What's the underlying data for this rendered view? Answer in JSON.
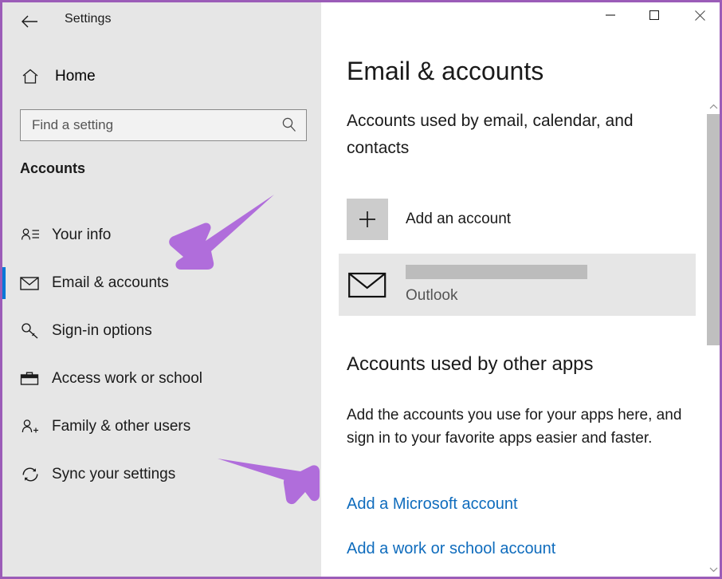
{
  "window": {
    "title": "Settings",
    "back_icon": "back-arrow-icon",
    "minimize_label": "—",
    "maximize_label": "☐",
    "close_label": "✕",
    "border_color": "#9b5cb8"
  },
  "sidebar": {
    "home_label": "Home",
    "home_icon": "home-icon",
    "search": {
      "placeholder": "Find a setting",
      "value": "",
      "icon": "search-icon"
    },
    "section_title": "Accounts",
    "selected_accent_color": "#0078d7",
    "items": [
      {
        "label": "Your info",
        "icon": "user-card-icon",
        "selected": false
      },
      {
        "label": "Email & accounts",
        "icon": "envelope-icon",
        "selected": true
      },
      {
        "label": "Sign-in options",
        "icon": "key-icon",
        "selected": false
      },
      {
        "label": "Access work or school",
        "icon": "briefcase-icon",
        "selected": false
      },
      {
        "label": "Family & other users",
        "icon": "user-plus-icon",
        "selected": false
      },
      {
        "label": "Sync your settings",
        "icon": "sync-refresh-icon",
        "selected": false
      }
    ]
  },
  "content": {
    "page_title": "Email & accounts",
    "sub_heading": "Accounts used by email, calendar, and contacts",
    "add_account": {
      "label": "Add an account",
      "icon": "plus-icon"
    },
    "account_tile": {
      "icon": "envelope-icon",
      "redacted_email": "",
      "provider": "Outlook"
    },
    "other_apps": {
      "heading": "Accounts used by other apps",
      "body": "Add the accounts you use for your apps here, and sign in to your favorite apps easier and faster.",
      "links": [
        {
          "label": "Add a Microsoft account",
          "color": "#0f6cbd"
        },
        {
          "label": "Add a work or school account",
          "color": "#0f6cbd"
        }
      ]
    }
  },
  "scrollbar": {
    "up_icon": "chevron-up-icon",
    "down_icon": "chevron-down-icon",
    "thumb_color": "#bfbfbf"
  },
  "annotations": {
    "arrow_color": "#b06ddb",
    "arrows": [
      {
        "name": "arrow-pointing-email-accounts",
        "target": "Email & accounts"
      },
      {
        "name": "arrow-pointing-add-microsoft-account",
        "target": "Add a Microsoft account"
      }
    ]
  }
}
